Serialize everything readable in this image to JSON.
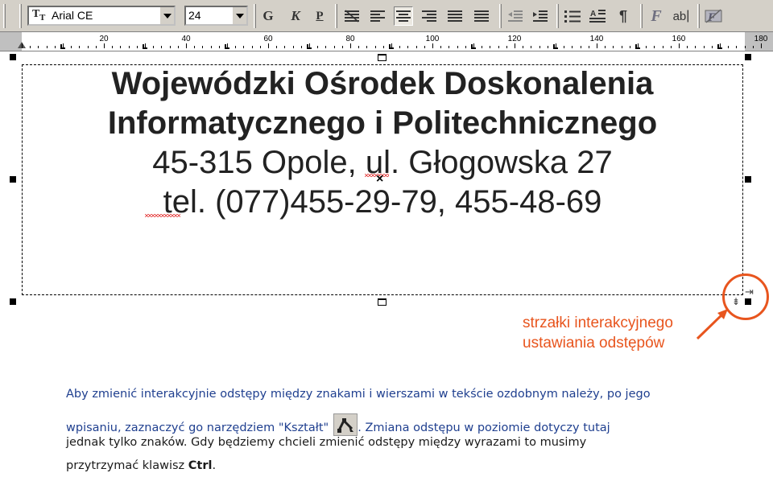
{
  "toolbar": {
    "font_name": "Arial CE",
    "font_size": "24",
    "font_icon": "Tr",
    "bold_label": "G",
    "italic_label": "K",
    "underline_label": "P",
    "paragraph_label": "¶",
    "fontwork_label": "F",
    "abc_label": "ab"
  },
  "ruler": {
    "labels": [
      "20",
      "40",
      "60",
      "80",
      "100",
      "120",
      "140",
      "160",
      "180"
    ]
  },
  "letterhead": {
    "line1": "Wojewódzki Ośrodek Doskonalenia",
    "line2": "Informatycznego i Politechnicznego",
    "line3": "45-315 Opole, ul. Głogowska 27",
    "line4": "tel. (077)455-29-79, 455-48-69"
  },
  "annotation": {
    "line1": "strzałki interakcyjnego",
    "line2": "ustawiania odstępów"
  },
  "caption": {
    "line1": "Aby zmienić interakcyjnie odstępy między znakami i wierszami w tekście ozdobnym należy, po jego",
    "line2a": "wpisaniu, zaznaczyć go narzędziem \"Kształt\"",
    "line2b": ". Zmiana odstępu w poziomie dotyczy tutaj",
    "line3": "jednak tylko znaków. Gdy będziemy chcieli zmienić odstępy między wyrazami to musimy",
    "line4a": "przytrzymać klawisz ",
    "line4b": "Ctrl",
    "line4c": "."
  },
  "colors": {
    "annotation": "#e8551e",
    "caption_blue": "#1f3f8f",
    "toolbar": "#d4d0c8"
  }
}
